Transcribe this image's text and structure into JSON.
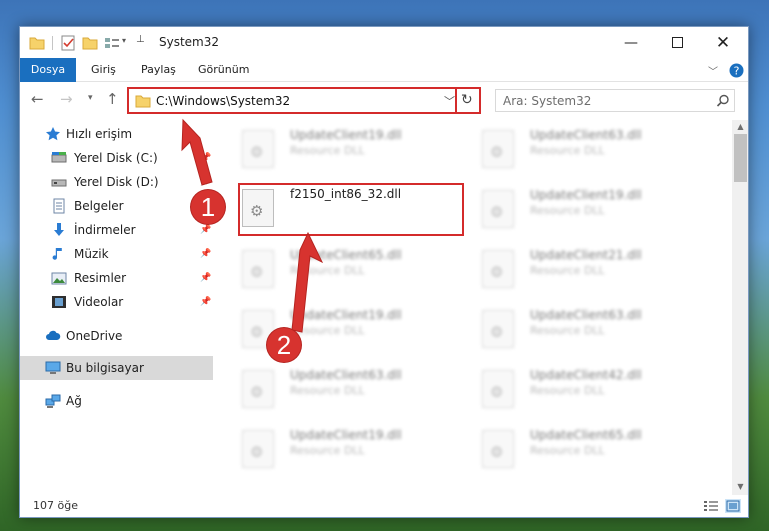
{
  "window": {
    "title": "System32"
  },
  "ribbon": {
    "tabs": [
      "Dosya",
      "Giriş",
      "Paylaş",
      "Görünüm"
    ]
  },
  "address": {
    "path": "C:\\Windows\\System32"
  },
  "search": {
    "placeholder": "Ara: System32"
  },
  "sidebar": {
    "items": [
      {
        "label": "Hızlı erişim",
        "icon": "star-icon",
        "pinned": false
      },
      {
        "label": "Yerel Disk (C:)",
        "icon": "drive-icon",
        "pinned": true
      },
      {
        "label": "Yerel Disk (D:)",
        "icon": "drive-icon",
        "pinned": true
      },
      {
        "label": "Belgeler",
        "icon": "document-icon",
        "pinned": true
      },
      {
        "label": "İndirmeler",
        "icon": "download-icon",
        "pinned": true
      },
      {
        "label": "Müzik",
        "icon": "music-icon",
        "pinned": true
      },
      {
        "label": "Resimler",
        "icon": "picture-icon",
        "pinned": true
      },
      {
        "label": "Videolar",
        "icon": "video-icon",
        "pinned": true
      },
      {
        "label": "OneDrive",
        "icon": "cloud-icon",
        "pinned": false
      },
      {
        "label": "Bu bilgisayar",
        "icon": "computer-icon",
        "pinned": false,
        "selected": true
      },
      {
        "label": "Ağ",
        "icon": "network-icon",
        "pinned": false
      }
    ]
  },
  "files": {
    "left": [
      {
        "name": "UpdateClient19.dll",
        "type": "Resource DLL"
      },
      {
        "name": "f2150_int86_32.dll",
        "type": "",
        "highlighted": true
      },
      {
        "name": "UpdateClient65.dll",
        "type": "Resource DLL"
      },
      {
        "name": "UpdateClient19.dll",
        "type": "Resource DLL"
      },
      {
        "name": "UpdateClient63.dll",
        "type": "Resource DLL"
      },
      {
        "name": "UpdateClient19.dll",
        "type": "Resource DLL"
      }
    ],
    "right": [
      {
        "name": "UpdateClient63.dll",
        "type": "Resource DLL"
      },
      {
        "name": "UpdateClient19.dll",
        "type": "Resource DLL"
      },
      {
        "name": "UpdateClient21.dll",
        "type": "Resource DLL"
      },
      {
        "name": "UpdateClient63.dll",
        "type": "Resource DLL"
      },
      {
        "name": "UpdateClient42.dll",
        "type": "Resource DLL"
      },
      {
        "name": "UpdateClient65.dll",
        "type": "Resource DLL"
      }
    ]
  },
  "status": {
    "item_count": "107 öğe"
  },
  "annotations": {
    "step1": "1",
    "step2": "2"
  },
  "colors": {
    "accent": "#1a6fbf",
    "highlight": "#d42b2b",
    "selected": "#d9d9d9"
  }
}
